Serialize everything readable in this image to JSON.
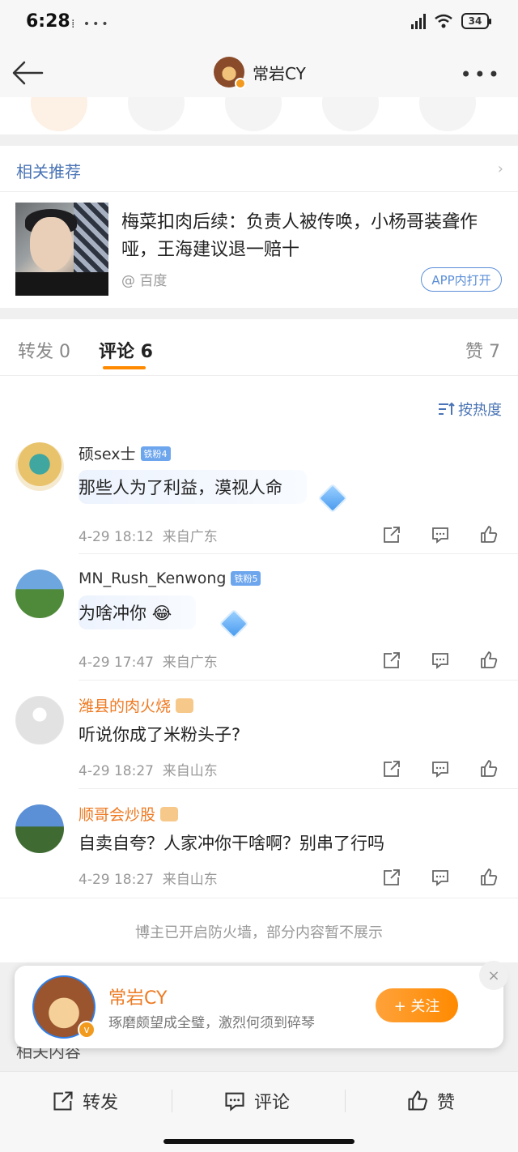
{
  "status_bar": {
    "time": "6:28",
    "icons": "⁞ •••",
    "signal": "HD",
    "battery": "34"
  },
  "nav": {
    "title": "常岩CY"
  },
  "related": {
    "header": "相关推荐",
    "title": "梅菜扣肉后续：负责人被传唤，小杨哥装聋作哑，王海建议退一赔十",
    "source": "@ 百度",
    "open_button": "APP内打开"
  },
  "tabs": {
    "repost": "转发 0",
    "comment": "评论 6",
    "like": "赞 7"
  },
  "sort": {
    "label": "按热度"
  },
  "comments": [
    {
      "name": "硕sex士",
      "badge": "铁粉4",
      "text": "那些人为了利益，漠视人命",
      "time": "4-29 18:12",
      "location": "来自广东"
    },
    {
      "name": "MN_Rush_Kenwong",
      "badge": "铁粉5",
      "text": "为啥冲你",
      "time": "4-29 17:47",
      "location": "来自广东"
    },
    {
      "name": "潍县的肉火烧",
      "text": "听说你成了米粉头子?",
      "time": "4-29 18:27",
      "location": "来自山东"
    },
    {
      "name": "顺哥会炒股",
      "text": "自卖自夸？人家冲你干啥啊？别串了行吗",
      "time": "4-29 18:27",
      "location": "来自山东"
    }
  ],
  "firewall_note": "博主已开启防火墙，部分内容暂不展示",
  "related_content": "相关内容",
  "popup": {
    "name": "常岩CY",
    "signature": "琢磨颇望成全璧，激烈何须到碎琴",
    "follow": "+ 关注",
    "close": "×"
  },
  "bottom_bar": {
    "repost": "转发",
    "comment": "评论",
    "like": "赞"
  }
}
